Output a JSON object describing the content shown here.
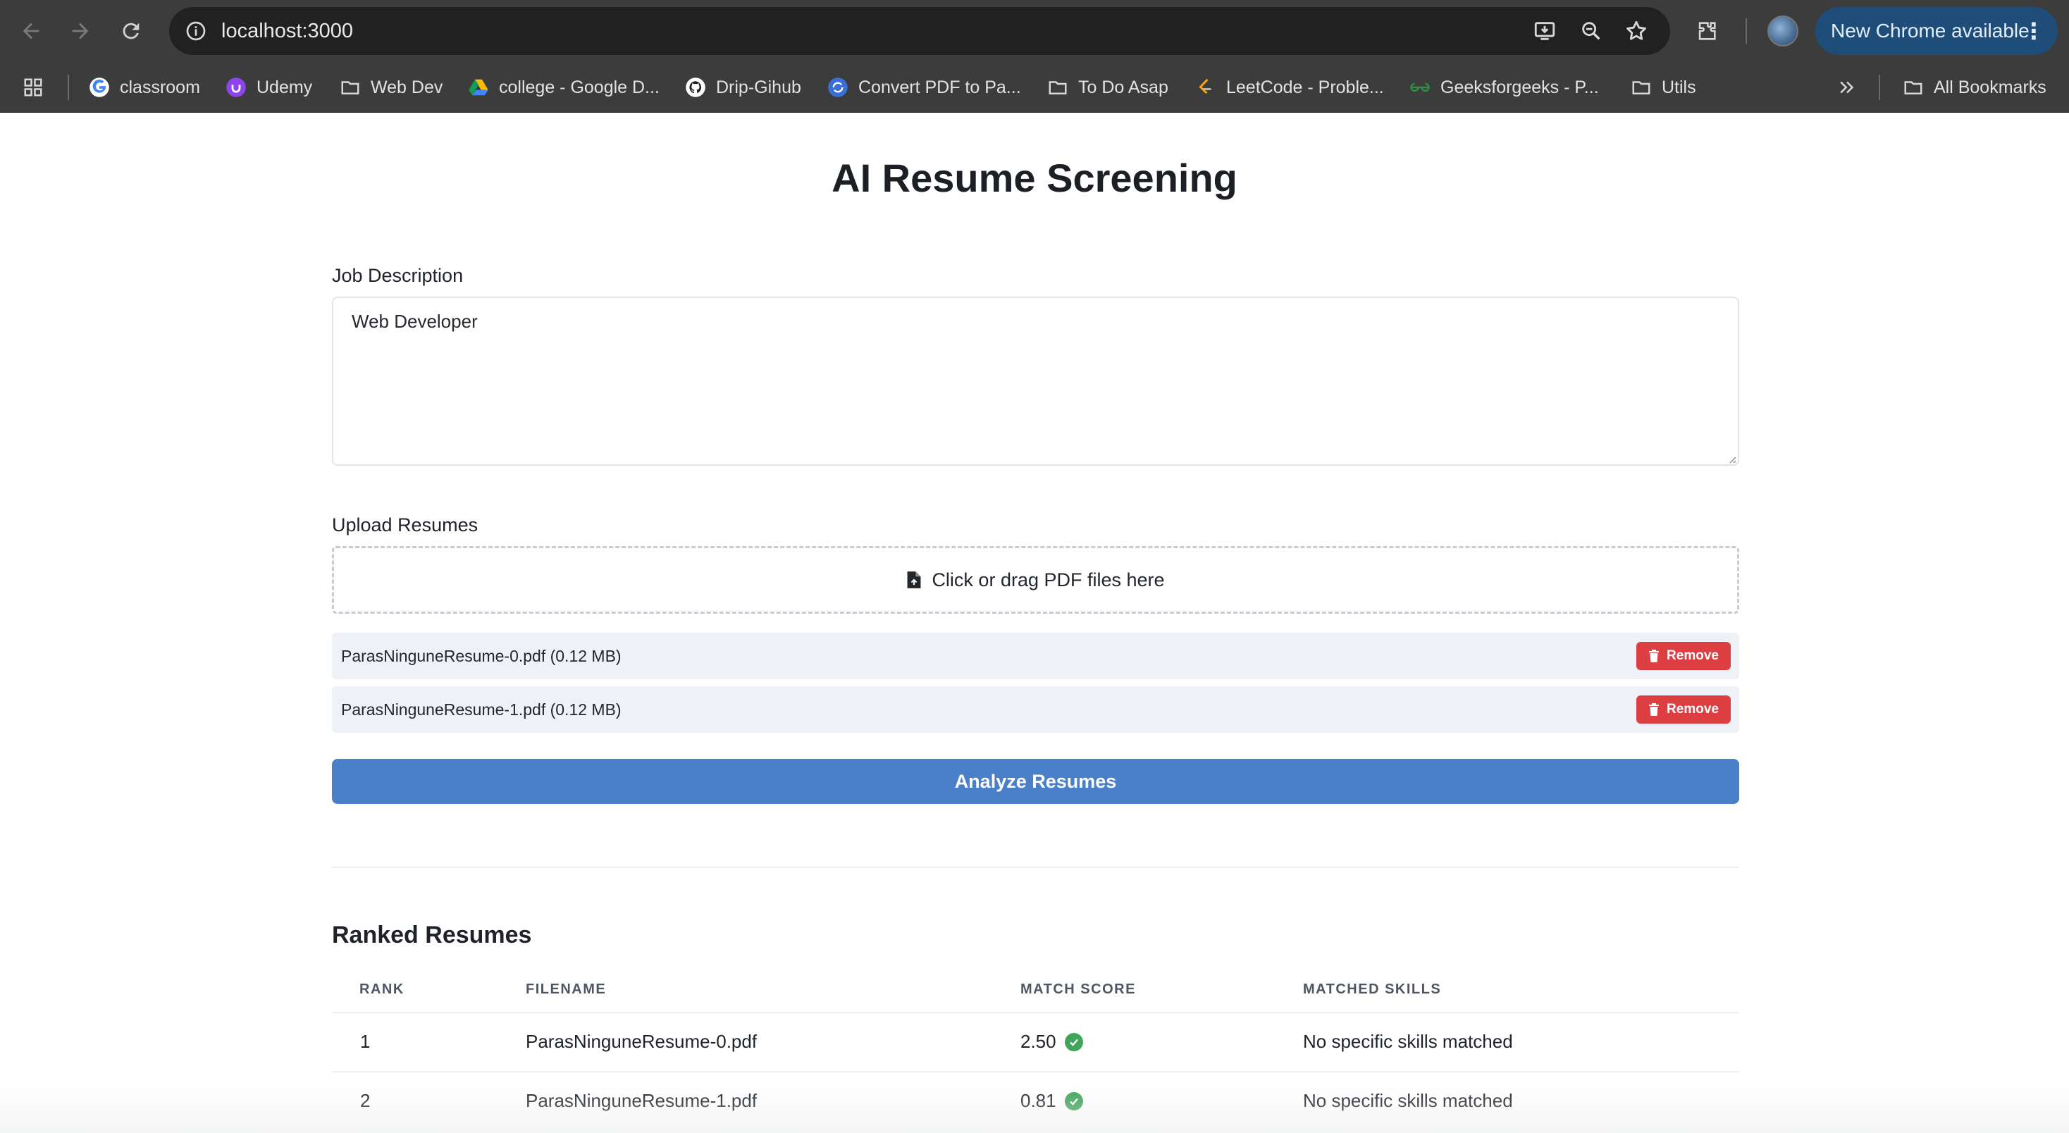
{
  "browser": {
    "url": "localhost:3000",
    "new_chrome_label": "New Chrome available",
    "bookmarks": [
      {
        "label": "classroom",
        "icon": "google-icon"
      },
      {
        "label": "Udemy",
        "icon": "udemy-icon"
      },
      {
        "label": "Web Dev",
        "icon": "folder-icon"
      },
      {
        "label": "college - Google D...",
        "icon": "google-drive-icon"
      },
      {
        "label": "Drip-Gihub",
        "icon": "github-icon"
      },
      {
        "label": "Convert PDF to Pa...",
        "icon": "convert-icon"
      },
      {
        "label": "To Do Asap",
        "icon": "folder-icon"
      },
      {
        "label": "LeetCode - Proble...",
        "icon": "leetcode-icon"
      },
      {
        "label": "Geeksforgeeks - P...",
        "icon": "gfg-icon"
      },
      {
        "label": "Utils",
        "icon": "folder-icon"
      }
    ],
    "all_bookmarks_label": "All Bookmarks"
  },
  "page": {
    "title": "AI Resume Screening",
    "job_description_label": "Job Description",
    "job_description_value": "Web Developer",
    "upload_label": "Upload Resumes",
    "dropzone_text": "Click or drag PDF files here",
    "files": [
      {
        "name": "ParasNinguneResume-0.pdf (0.12 MB)",
        "remove_label": "Remove"
      },
      {
        "name": "ParasNinguneResume-1.pdf (0.12 MB)",
        "remove_label": "Remove"
      }
    ],
    "analyze_label": "Analyze Resumes",
    "results_title": "Ranked Resumes",
    "columns": [
      "RANK",
      "FILENAME",
      "MATCH SCORE",
      "MATCHED SKILLS"
    ],
    "rows": [
      {
        "rank": "1",
        "filename": "ParasNinguneResume-0.pdf",
        "score": "2.50",
        "skills": "No specific skills matched"
      },
      {
        "rank": "2",
        "filename": "ParasNinguneResume-1.pdf",
        "score": "0.81",
        "skills": "No specific skills matched"
      }
    ]
  },
  "colors": {
    "chrome_bg": "#3c3c3c",
    "omnibox_bg": "#212121",
    "primary_button": "#4a80c8",
    "remove_button": "#dc3e42",
    "check_green": "#3ea55a"
  }
}
